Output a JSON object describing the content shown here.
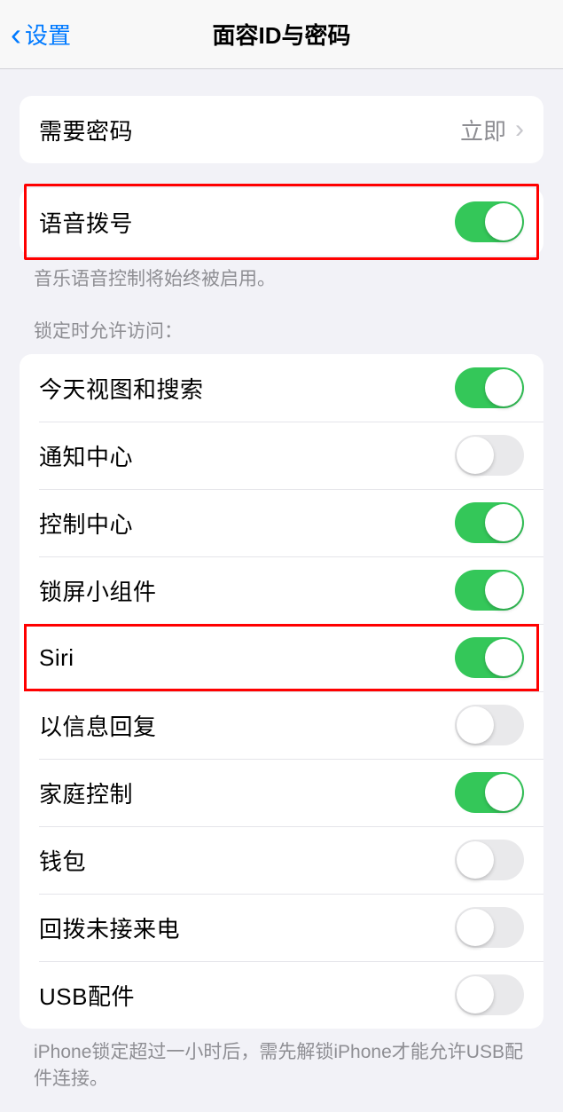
{
  "header": {
    "back_label": "设置",
    "title": "面容ID与密码"
  },
  "require_passcode": {
    "label": "需要密码",
    "value": "立即"
  },
  "voice_dial": {
    "label": "语音拨号",
    "footer": "音乐语音控制将始终被启用。",
    "enabled": true
  },
  "lock_access": {
    "header": "锁定时允许访问：",
    "items": [
      {
        "label": "今天视图和搜索",
        "enabled": true
      },
      {
        "label": "通知中心",
        "enabled": false
      },
      {
        "label": "控制中心",
        "enabled": true
      },
      {
        "label": "锁屏小组件",
        "enabled": true
      },
      {
        "label": "Siri",
        "enabled": true
      },
      {
        "label": "以信息回复",
        "enabled": false
      },
      {
        "label": "家庭控制",
        "enabled": true
      },
      {
        "label": "钱包",
        "enabled": false
      },
      {
        "label": "回拨未接来电",
        "enabled": false
      },
      {
        "label": "USB配件",
        "enabled": false
      }
    ],
    "footer": "iPhone锁定超过一小时后，需先解锁iPhone才能允许USB配件连接。"
  }
}
